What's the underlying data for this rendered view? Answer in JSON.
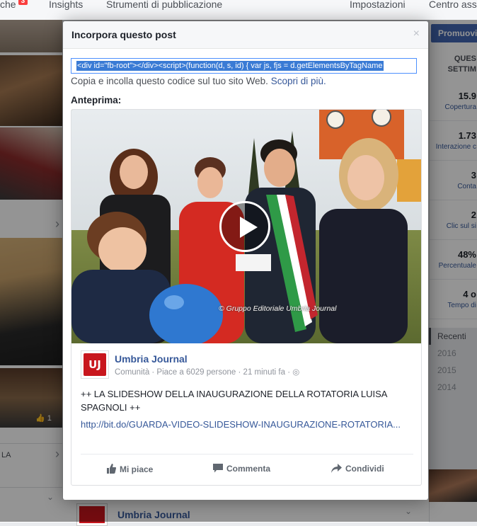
{
  "topbar": {
    "tab_partial": "che",
    "notif_count": "3",
    "tab_insights": "Insights",
    "tab_tools": "Strumenti di pubblicazione",
    "tab_settings": "Impostazioni",
    "tab_support": "Centro ass"
  },
  "right_panel": {
    "promote_label": "Promuovi",
    "header_line1": "QUES",
    "header_line2": "SETTIM",
    "stats": [
      {
        "value": "15.9",
        "label": "Copertura"
      },
      {
        "value": "1.73",
        "label": "Interazione c"
      },
      {
        "value": "3",
        "label": "Conta"
      },
      {
        "value": "2",
        "label": "Clic sul si"
      },
      {
        "value": "48%",
        "label": "Percentuale"
      },
      {
        "value": "4 o",
        "label": "Tempo di"
      }
    ],
    "years": [
      "Recenti",
      "2016",
      "2015",
      "2014"
    ]
  },
  "left_panel": {
    "label_la": "LA",
    "photo_count": "1"
  },
  "modal": {
    "title": "Incorpora questo post",
    "close_symbol": "×",
    "embed_code": "<div id=\"fb-root\"></div><script>(function(d, s, id) {  var js, fjs = d.getElementsByTagName",
    "instructions": "Copia e incolla questo codice sul tuo sito Web.",
    "learn_more": "Scopri di più.",
    "preview_label": "Anteprima:"
  },
  "post": {
    "page_name": "Umbria Journal",
    "logo_text": "UJ",
    "meta": "Comunità · Piace a 6029 persone · 21 minuti fa · ",
    "text": "++ LA SLIDESHOW DELLA INAUGURAZIONE DELLA ROTATORIA LUISA SPAGNOLI ++",
    "link": "http://bit.do/GUARDA-VIDEO-SLIDESHOW-INAUGURAZIONE-ROTATORIA...",
    "photo_credit": "© Gruppo Editoriale Umbria Journal",
    "like_label": "Mi piace",
    "comment_label": "Commenta",
    "share_label": "Condividi"
  },
  "background_post": {
    "page_name": "Umbria Journal"
  },
  "colors": {
    "link": "#365899",
    "brand_red": "#c8161d",
    "selection": "#3a7bd5"
  }
}
